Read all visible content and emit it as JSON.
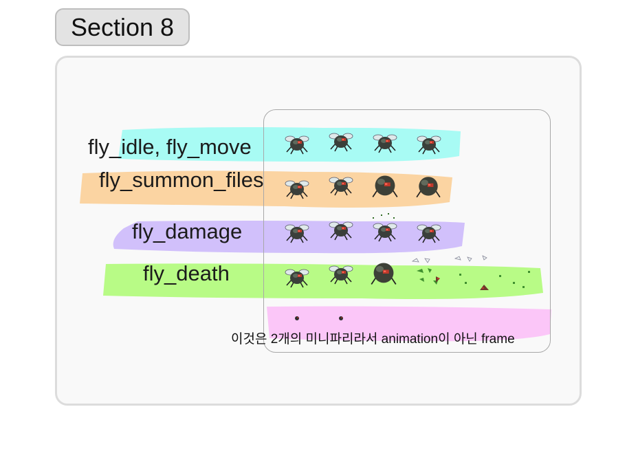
{
  "section": {
    "title": "Section 8"
  },
  "rows": [
    {
      "label": "fly_idle, fly_move",
      "highlight": "#a8fbf4",
      "frames": [
        "fly-idle-frame-1",
        "fly-idle-frame-2",
        "fly-idle-frame-3",
        "fly-idle-frame-4"
      ]
    },
    {
      "label": "fly_summon_files",
      "highlight": "#fbd4a2",
      "frames": [
        "fly-summon-frame-1",
        "fly-summon-frame-2",
        "fly-summon-frame-3",
        "fly-summon-frame-4"
      ]
    },
    {
      "label": "fly_damage",
      "highlight": "#d1c0fb",
      "frames": [
        "fly-damage-frame-1",
        "fly-damage-frame-2",
        "fly-damage-frame-3",
        "fly-damage-frame-4"
      ]
    },
    {
      "label": "fly_death",
      "highlight": "#b8fb86",
      "frames": [
        "fly-death-frame-1",
        "fly-death-frame-2",
        "fly-death-frame-3",
        "fly-death-frame-4",
        "fly-death-frame-5"
      ]
    }
  ],
  "note": {
    "text": "이것은 2개의 미니파리라서 animation이 아닌 frame",
    "highlight": "#fbc6f8"
  }
}
